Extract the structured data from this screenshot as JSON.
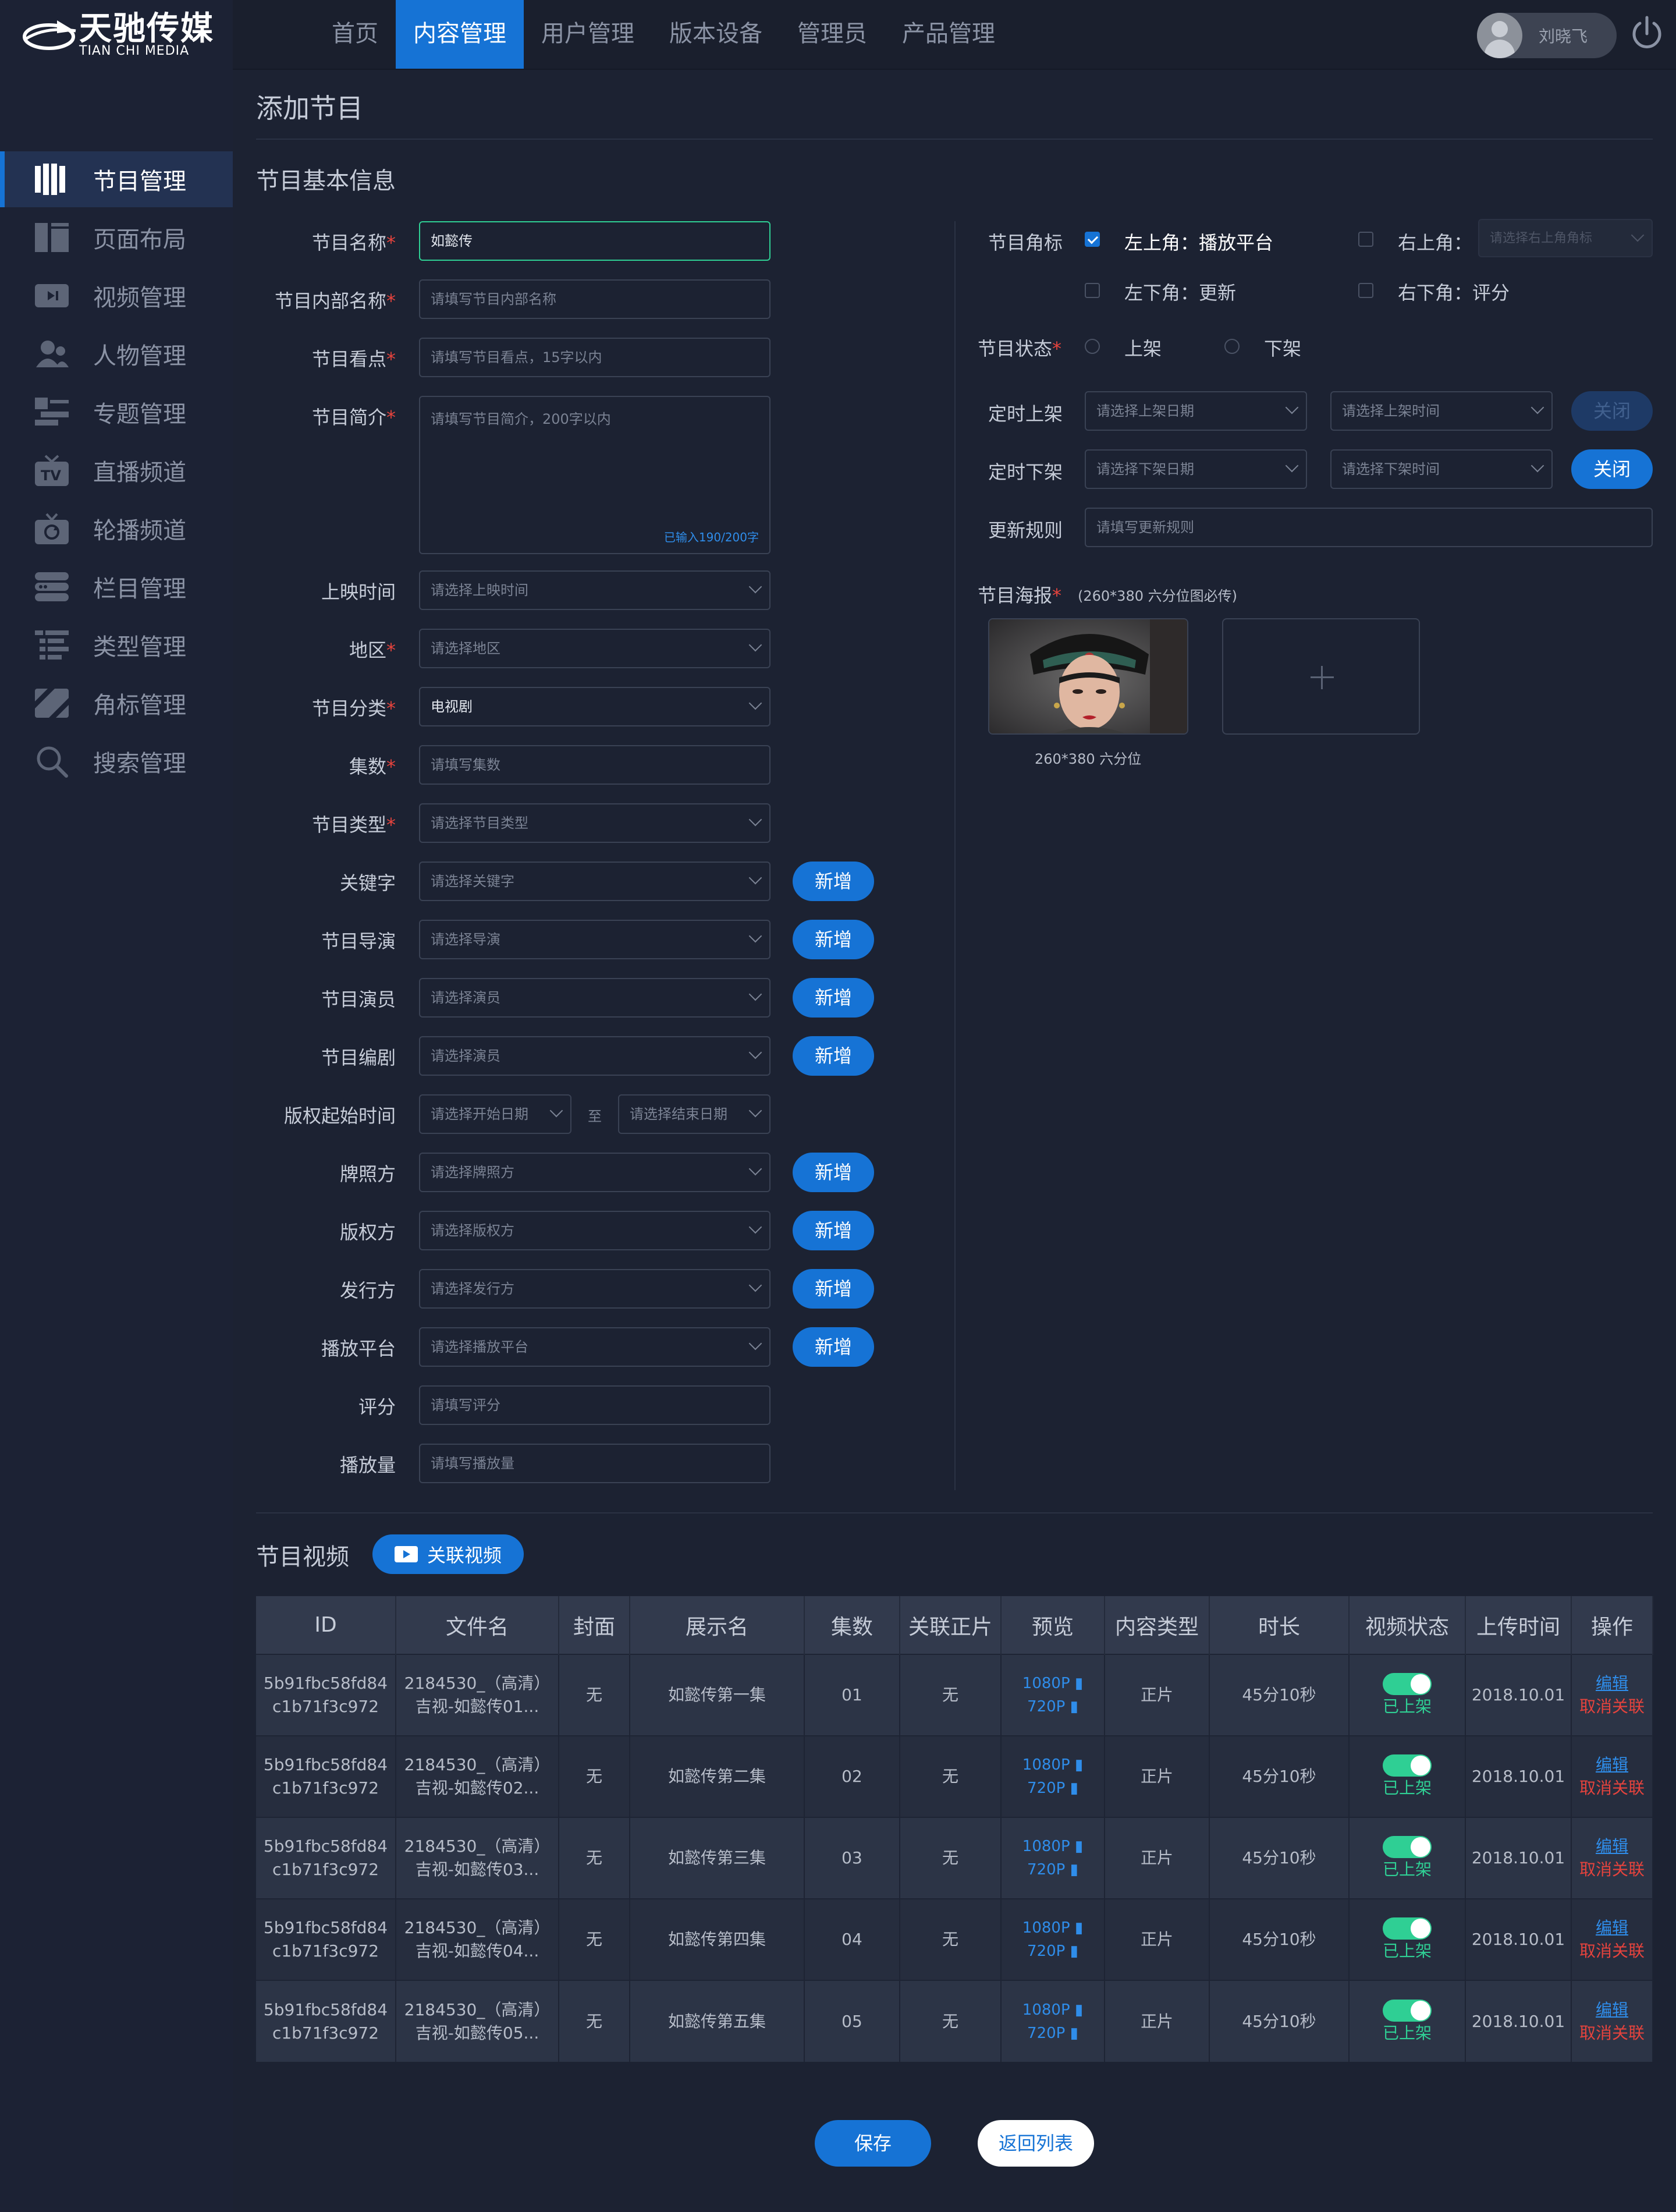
{
  "brand": {
    "name_cn": "天驰传媒",
    "name_en": "TIAN CHI MEDIA"
  },
  "nav": [
    {
      "label": "首页"
    },
    {
      "label": "内容管理",
      "active": true
    },
    {
      "label": "用户管理"
    },
    {
      "label": "版本设备"
    },
    {
      "label": "管理员"
    },
    {
      "label": "产品管理"
    }
  ],
  "user": {
    "name": "刘晓飞"
  },
  "sidebar": [
    {
      "label": "节目管理",
      "icon": "program-icon",
      "active": true
    },
    {
      "label": "页面布局",
      "icon": "layout-icon"
    },
    {
      "label": "视频管理",
      "icon": "video-icon"
    },
    {
      "label": "人物管理",
      "icon": "people-icon"
    },
    {
      "label": "专题管理",
      "icon": "topic-icon"
    },
    {
      "label": "直播频道",
      "icon": "tv-icon"
    },
    {
      "label": "轮播频道",
      "icon": "carousel-icon"
    },
    {
      "label": "栏目管理",
      "icon": "column-icon"
    },
    {
      "label": "类型管理",
      "icon": "type-icon"
    },
    {
      "label": "角标管理",
      "icon": "badge-icon"
    },
    {
      "label": "搜索管理",
      "icon": "search-icon"
    }
  ],
  "page_title": "添加节目",
  "basic": {
    "title": "节目基本信息"
  },
  "form": {
    "name": {
      "label": "节目名称",
      "value": "如懿传"
    },
    "inner_name": {
      "label": "节目内部名称",
      "placeholder": "请填写节目内部名称"
    },
    "highlight": {
      "label": "节目看点",
      "placeholder": "请填写节目看点，15字以内"
    },
    "intro": {
      "label": "节目简介",
      "placeholder": "请填写节目简介，200字以内",
      "counter": "已输入190/200字"
    },
    "release": {
      "label": "上映时间",
      "placeholder": "请选择上映时间"
    },
    "region": {
      "label": "地区",
      "placeholder": "请选择地区"
    },
    "category": {
      "label": "节目分类",
      "value": "电视剧"
    },
    "episodes": {
      "label": "集数",
      "placeholder": "请填写集数"
    },
    "ptype": {
      "label": "节目类型",
      "placeholder": "请选择节目类型"
    },
    "keywords": {
      "label": "关键字",
      "placeholder": "请选择关键字"
    },
    "director": {
      "label": "节目导演",
      "placeholder": "请选择导演"
    },
    "actor": {
      "label": "节目演员",
      "placeholder": "请选择演员"
    },
    "writer": {
      "label": "节目编剧",
      "placeholder": "请选择演员"
    },
    "copyright_period": {
      "label": "版权起始时间",
      "start": "请选择开始日期",
      "sep": "至",
      "end": "请选择结束日期"
    },
    "license": {
      "label": "牌照方",
      "placeholder": "请选择牌照方"
    },
    "copyright": {
      "label": "版权方",
      "placeholder": "请选择版权方"
    },
    "publisher": {
      "label": "发行方",
      "placeholder": "请选择发行方"
    },
    "platform": {
      "label": "播放平台",
      "placeholder": "请选择播放平台"
    },
    "score": {
      "label": "评分",
      "placeholder": "请填写评分"
    },
    "plays": {
      "label": "播放量",
      "placeholder": "请填写播放量"
    },
    "add_label": "新增"
  },
  "right": {
    "corner": {
      "label": "节目角标",
      "tl": "左上角：播放平台",
      "tr": "右上角：",
      "tr_placeholder": "请选择右上角角标",
      "bl": "左下角：更新",
      "br": "右下角：评分"
    },
    "status": {
      "label": "节目状态",
      "on": "上架",
      "off": "下架"
    },
    "sched_on": {
      "label": "定时上架",
      "date": "请选择上架日期",
      "time": "请选择上架时间",
      "btn": "关闭"
    },
    "sched_off": {
      "label": "定时下架",
      "date": "请选择下架日期",
      "time": "请选择下架时间",
      "btn": "关闭"
    },
    "rule": {
      "label": "更新规则",
      "placeholder": "请填写更新规则"
    },
    "poster": {
      "label": "节目海报",
      "note": "(260*380 六分位图必传)",
      "caption": "260*380 六分位"
    }
  },
  "video": {
    "title": "节目视频",
    "link_btn": "关联视频",
    "columns": [
      "ID",
      "文件名",
      "封面",
      "展示名",
      "集数",
      "关联正片",
      "预览",
      "内容类型",
      "时长",
      "视频状态",
      "上传时间",
      "操作"
    ],
    "rows": [
      {
        "id1": "5b91fbc58fd84",
        "id2": "c1b71f3c972",
        "f1": "2184530_（高清）",
        "f2": "吉视-如懿传01...",
        "cover": "无",
        "display": "如懿传第一集",
        "ep": "01",
        "linked": "无",
        "p1": "1080P",
        "p2": "720P",
        "ctype": "正片",
        "dur": "45分10秒",
        "status": "已上架",
        "time": "2018.10.01",
        "edit": "编辑",
        "unlink": "取消关联"
      },
      {
        "id1": "5b91fbc58fd84",
        "id2": "c1b71f3c972",
        "f1": "2184530_（高清）",
        "f2": "吉视-如懿传02...",
        "cover": "无",
        "display": "如懿传第二集",
        "ep": "02",
        "linked": "无",
        "p1": "1080P",
        "p2": "720P",
        "ctype": "正片",
        "dur": "45分10秒",
        "status": "已上架",
        "time": "2018.10.01",
        "edit": "编辑",
        "unlink": "取消关联"
      },
      {
        "id1": "5b91fbc58fd84",
        "id2": "c1b71f3c972",
        "f1": "2184530_（高清）",
        "f2": "吉视-如懿传03...",
        "cover": "无",
        "display": "如懿传第三集",
        "ep": "03",
        "linked": "无",
        "p1": "1080P",
        "p2": "720P",
        "ctype": "正片",
        "dur": "45分10秒",
        "status": "已上架",
        "time": "2018.10.01",
        "edit": "编辑",
        "unlink": "取消关联"
      },
      {
        "id1": "5b91fbc58fd84",
        "id2": "c1b71f3c972",
        "f1": "2184530_（高清）",
        "f2": "吉视-如懿传04...",
        "cover": "无",
        "display": "如懿传第四集",
        "ep": "04",
        "linked": "无",
        "p1": "1080P",
        "p2": "720P",
        "ctype": "正片",
        "dur": "45分10秒",
        "status": "已上架",
        "time": "2018.10.01",
        "edit": "编辑",
        "unlink": "取消关联"
      },
      {
        "id1": "5b91fbc58fd84",
        "id2": "c1b71f3c972",
        "f1": "2184530_（高清）",
        "f2": "吉视-如懿传05...",
        "cover": "无",
        "display": "如懿传第五集",
        "ep": "05",
        "linked": "无",
        "p1": "1080P",
        "p2": "720P",
        "ctype": "正片",
        "dur": "45分10秒",
        "status": "已上架",
        "time": "2018.10.01",
        "edit": "编辑",
        "unlink": "取消关联"
      }
    ]
  },
  "footer": {
    "save": "保存",
    "back": "返回列表"
  },
  "colors": {
    "accent": "#1673d5",
    "bg": "#1c2232",
    "sidebar": "#1c2234",
    "success": "#2fcf94",
    "danger": "#e5433d"
  }
}
